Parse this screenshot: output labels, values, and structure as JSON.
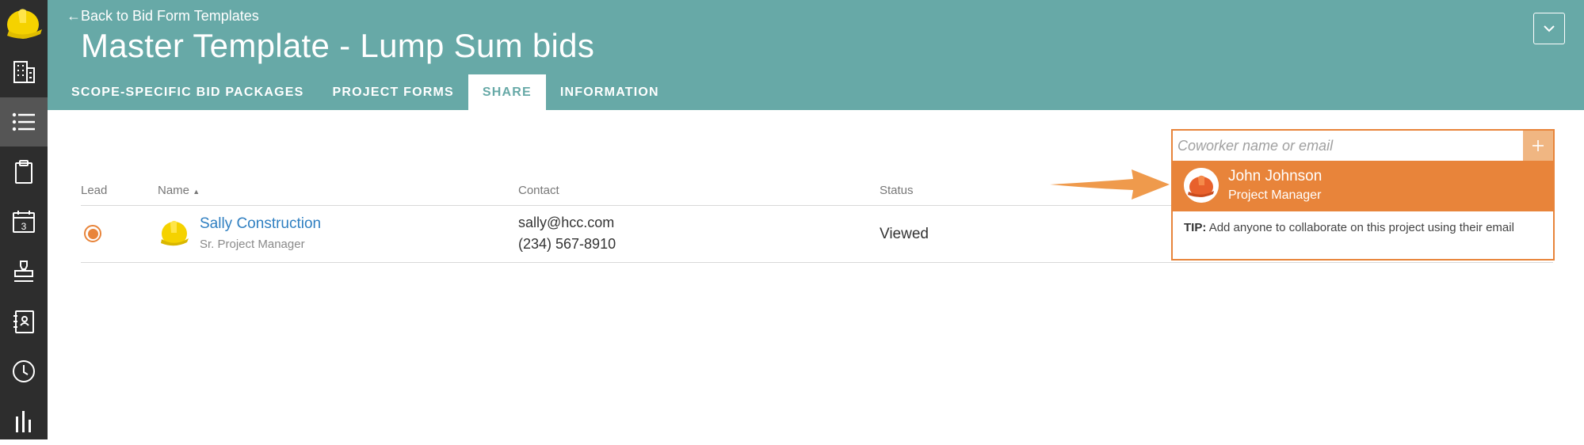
{
  "sidebar": {
    "items": [
      {
        "icon": "building-icon",
        "active": false
      },
      {
        "icon": "list-icon",
        "active": true
      },
      {
        "icon": "clipboard-icon",
        "active": false
      },
      {
        "icon": "calendar-icon",
        "active": false,
        "number": "3"
      },
      {
        "icon": "stamp-icon",
        "active": false
      },
      {
        "icon": "contacts-book-icon",
        "active": false
      },
      {
        "icon": "clock-icon",
        "active": false
      },
      {
        "icon": "bar-chart-icon",
        "active": false
      }
    ]
  },
  "header": {
    "back_label": "Back to Bid Form Templates",
    "title": "Master Template - Lump Sum bids",
    "tabs": [
      {
        "label": "SCOPE-SPECIFIC BID PACKAGES",
        "active": false
      },
      {
        "label": "PROJECT FORMS",
        "active": false
      },
      {
        "label": "SHARE",
        "active": true
      },
      {
        "label": "INFORMATION",
        "active": false
      }
    ]
  },
  "table": {
    "columns": {
      "lead": "Lead",
      "name": "Name",
      "contact": "Contact",
      "status": "Status"
    },
    "rows": [
      {
        "lead": true,
        "name": "Sally Construction",
        "title": "Sr. Project Manager",
        "email": "sally@hcc.com",
        "phone": "(234) 567-8910",
        "status": "Viewed"
      }
    ]
  },
  "share": {
    "placeholder": "Coworker name or email",
    "value": "",
    "suggestion": {
      "name": "John Johnson",
      "role": "Project Manager"
    },
    "tip_label": "TIP:",
    "tip_text": "Add anyone to collaborate on this project using their email"
  },
  "colors": {
    "header": "#67a9a7",
    "sidebar": "#2d2d2d",
    "accent": "#e8843a",
    "link": "#2f7fc1"
  }
}
